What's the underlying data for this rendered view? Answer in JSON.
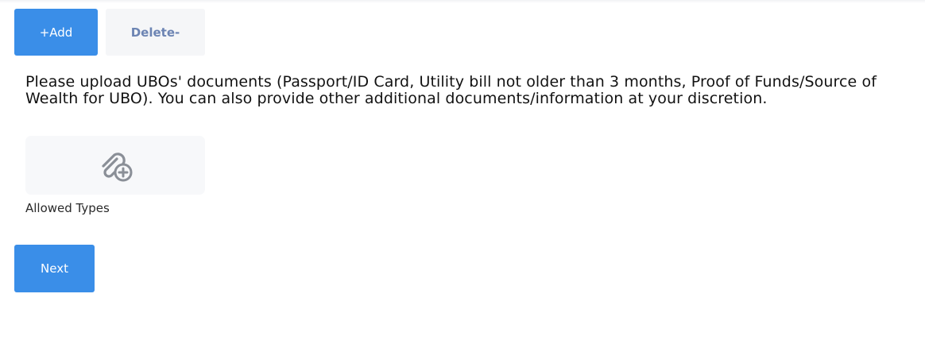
{
  "actions": {
    "add_label": "+Add",
    "delete_label": "Delete-"
  },
  "upload": {
    "instructions": "Please upload UBOs' documents (Passport/ID Card, Utility bill not older than 3 months, Proof of Funds/Source of Wealth for UBO). You can also provide other additional documents/information at your discretion.",
    "icon": "attach-file-add-icon",
    "allowed_types_label": "Allowed Types"
  },
  "footer": {
    "next_label": "Next"
  },
  "colors": {
    "primary": "#3a8ee8",
    "delete_text": "#6c84b3",
    "secondary_bg": "#f5f6f8",
    "icon": "#8a8f97"
  }
}
